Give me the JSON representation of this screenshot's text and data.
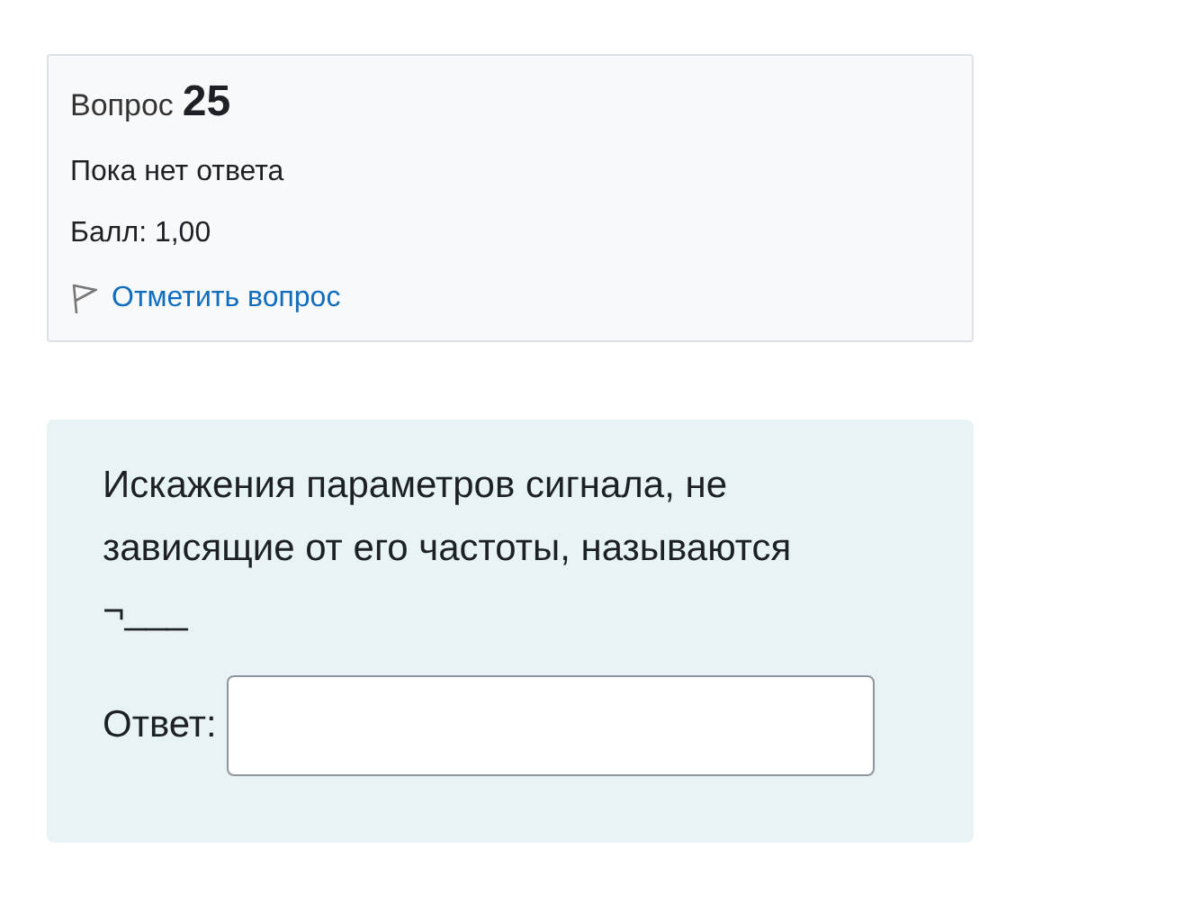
{
  "info": {
    "label": "Вопрос",
    "number": "25",
    "status": "Пока нет ответа",
    "grade": "Балл: 1,00",
    "flag_link": "Отметить вопрос"
  },
  "question": {
    "text": "Искажения параметров сигнала, не зависящие от его частоты, называются ¬___",
    "answer_label": "Ответ:"
  }
}
